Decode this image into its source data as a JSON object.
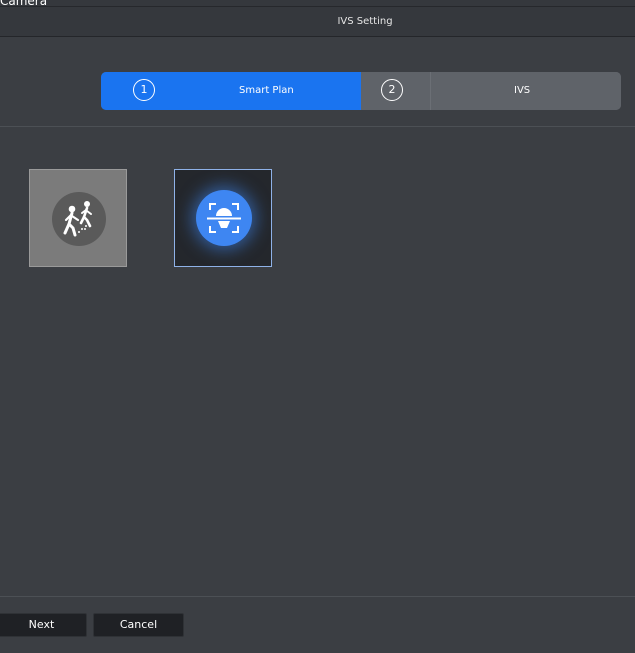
{
  "window": {
    "title": "Camera"
  },
  "dialog": {
    "title": "IVS Setting"
  },
  "steps": [
    {
      "number": "1",
      "label": "Smart Plan",
      "active": true
    },
    {
      "number": "2",
      "label": "IVS",
      "active": false
    }
  ],
  "plans": [
    {
      "icon": "people-walking-icon",
      "selected": false
    },
    {
      "icon": "face-detection-icon",
      "selected": true
    }
  ],
  "buttons": {
    "next_label": "Next",
    "cancel_label": "Cancel"
  },
  "colors": {
    "background": "#3b3e43",
    "active_step": "#1a74f0",
    "inactive_step": "#5f6369",
    "selected_plan_circle": "#3e86f2"
  }
}
